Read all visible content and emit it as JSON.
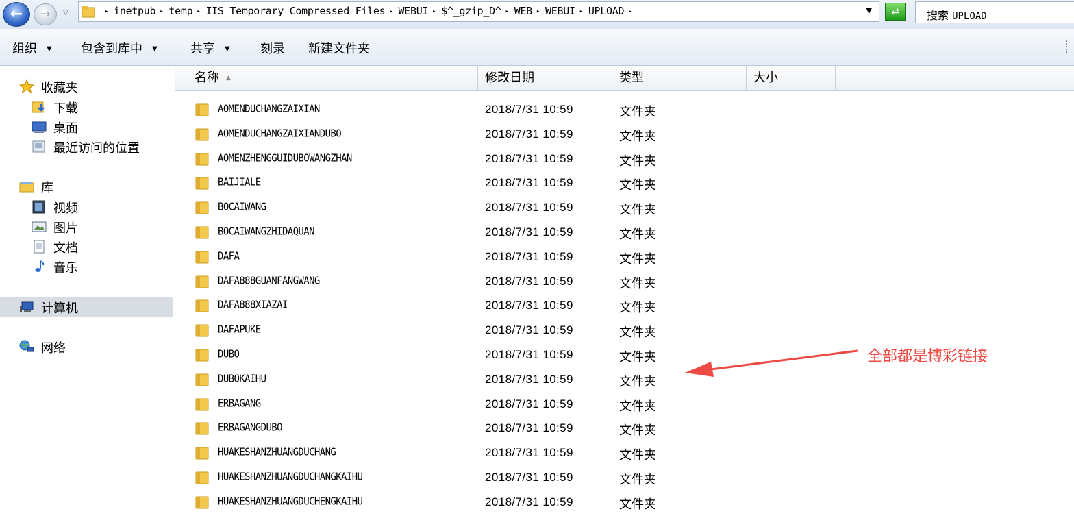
{
  "address_bar": {
    "crumbs": [
      "inetpub",
      "temp",
      "IIS Temporary Compressed Files",
      "WEBUI",
      "$^_gzip_D^",
      "WEB",
      "WEBUI",
      "UPLOAD"
    ],
    "search_label": "搜索",
    "search_scope": "UPLOAD"
  },
  "toolbar": {
    "organize": "组织",
    "include_in_library": "包含到库中",
    "share": "共享",
    "burn": "刻录",
    "new_folder": "新建文件夹"
  },
  "nav": {
    "favorites": "收藏夹",
    "downloads": "下载",
    "desktop": "桌面",
    "recent": "最近访问的位置",
    "libraries": "库",
    "videos": "视频",
    "pictures": "图片",
    "documents": "文档",
    "music": "音乐",
    "computer": "计算机",
    "network": "网络"
  },
  "columns": {
    "name": "名称",
    "modified": "修改日期",
    "type": "类型",
    "size": "大小"
  },
  "files": [
    {
      "name": "AOMENDUCHANGZAIXIAN",
      "modified": "2018/7/31 10:59",
      "type": "文件夹"
    },
    {
      "name": "AOMENDUCHANGZAIXIANDUBO",
      "modified": "2018/7/31 10:59",
      "type": "文件夹"
    },
    {
      "name": "AOMENZHENGGUIDUBOWANGZHAN",
      "modified": "2018/7/31 10:59",
      "type": "文件夹"
    },
    {
      "name": "BAIJIALE",
      "modified": "2018/7/31 10:59",
      "type": "文件夹"
    },
    {
      "name": "BOCAIWANG",
      "modified": "2018/7/31 10:59",
      "type": "文件夹"
    },
    {
      "name": "BOCAIWANGZHIDAQUAN",
      "modified": "2018/7/31 10:59",
      "type": "文件夹"
    },
    {
      "name": "DAFA",
      "modified": "2018/7/31 10:59",
      "type": "文件夹"
    },
    {
      "name": "DAFA888GUANFANGWANG",
      "modified": "2018/7/31 10:59",
      "type": "文件夹"
    },
    {
      "name": "DAFA888XIAZAI",
      "modified": "2018/7/31 10:59",
      "type": "文件夹"
    },
    {
      "name": "DAFAPUKE",
      "modified": "2018/7/31 10:59",
      "type": "文件夹"
    },
    {
      "name": "DUBO",
      "modified": "2018/7/31 10:59",
      "type": "文件夹"
    },
    {
      "name": "DUBOKAIHU",
      "modified": "2018/7/31 10:59",
      "type": "文件夹"
    },
    {
      "name": "ERBAGANG",
      "modified": "2018/7/31 10:59",
      "type": "文件夹"
    },
    {
      "name": "ERBAGANGDUBO",
      "modified": "2018/7/31 10:59",
      "type": "文件夹"
    },
    {
      "name": "HUAKESHANZHUANGDUCHANG",
      "modified": "2018/7/31 10:59",
      "type": "文件夹"
    },
    {
      "name": "HUAKESHANZHUANGDUCHANGKAIHU",
      "modified": "2018/7/31 10:59",
      "type": "文件夹"
    },
    {
      "name": "HUAKESHANZHUANGDUCHENGKAIHU",
      "modified": "2018/7/31 10:59",
      "type": "文件夹"
    }
  ],
  "annotation": "全部都是博彩链接",
  "colors": {
    "annotation": "#ee4a44",
    "folder": "#f2c94c",
    "selection": "#d8dde3"
  }
}
